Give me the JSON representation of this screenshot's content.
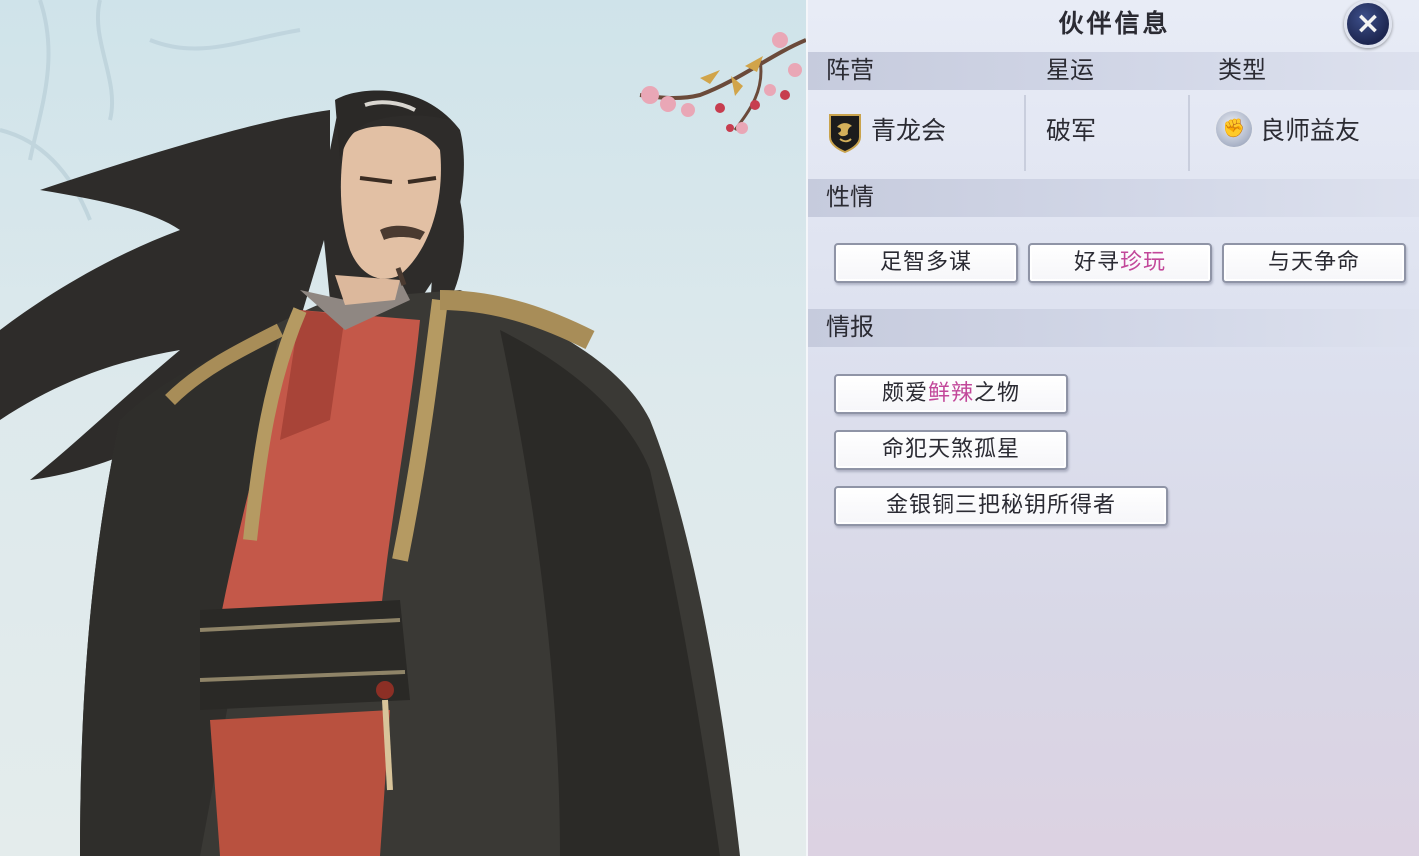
{
  "panel": {
    "title": "伙伴信息",
    "close_icon": "×"
  },
  "headers": {
    "faction": "阵营",
    "fate": "星运",
    "type": "类型"
  },
  "values": {
    "faction": "青龙会",
    "faction_icon": "dragon-shield-icon",
    "fate": "破军",
    "type": "良师益友",
    "type_icon": "fist-icon"
  },
  "personality": {
    "label": "性情",
    "traits": [
      {
        "pre": "足智多谋",
        "hl": "",
        "post": ""
      },
      {
        "pre": "好寻",
        "hl": "珍玩",
        "post": ""
      },
      {
        "pre": "与天争命",
        "hl": "",
        "post": ""
      }
    ]
  },
  "intel": {
    "label": "情报",
    "items": [
      {
        "pre": "颇爱",
        "hl": "鲜辣",
        "post": "之物"
      },
      {
        "pre": "命犯天煞孤星",
        "hl": "",
        "post": ""
      },
      {
        "pre": "金银铜三把秘钥所得者",
        "hl": "",
        "post": ""
      }
    ]
  },
  "colors": {
    "highlight": "#c2489a",
    "text": "#2b2b33",
    "close_button": "#1d2650"
  }
}
